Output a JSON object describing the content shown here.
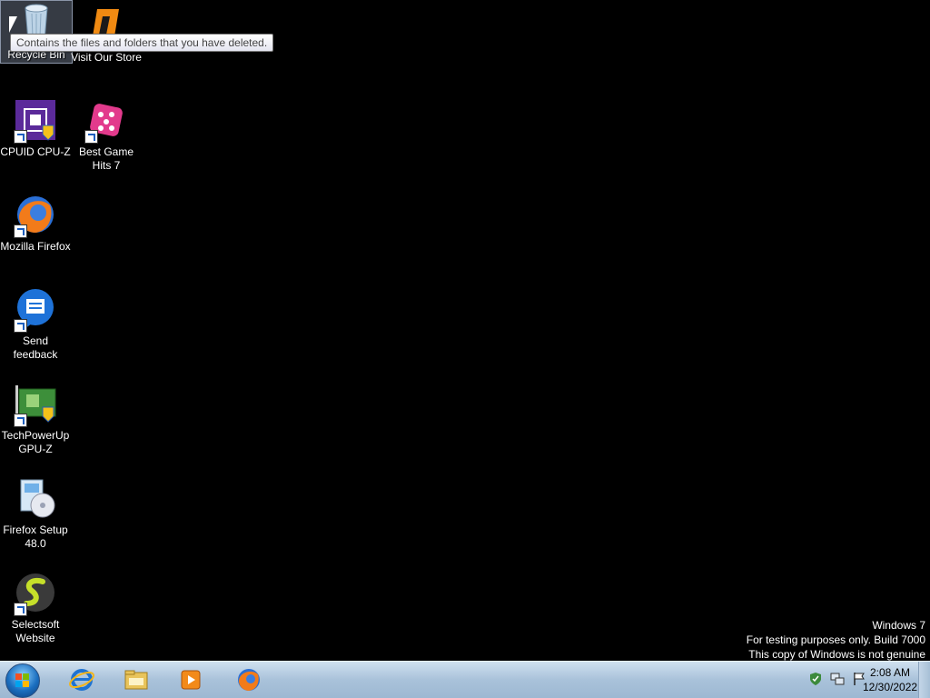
{
  "desktop": {
    "icons": [
      {
        "label": "Recycle Bin",
        "icon": "recycle-bin-icon"
      },
      {
        "label": "Visit Our Store",
        "icon": "store-icon"
      },
      {
        "label": "CPUID CPU-Z",
        "icon": "cpu-z-icon"
      },
      {
        "label": "Best Game Hits 7",
        "icon": "dice-icon"
      },
      {
        "label": "Mozilla Firefox",
        "icon": "firefox-icon"
      },
      {
        "label": "Send feedback",
        "icon": "feedback-icon"
      },
      {
        "label": "TechPowerUp GPU-Z",
        "icon": "gpu-z-icon"
      },
      {
        "label": "Firefox Setup 48.0",
        "icon": "installer-icon"
      },
      {
        "label": "Selectsoft Website",
        "icon": "selectsoft-icon"
      }
    ],
    "tooltip": "Contains the files and folders that you have deleted."
  },
  "watermark": {
    "line1": "Windows 7",
    "line2": "For testing purposes only. Build 7000",
    "line3": "This copy of Windows is not genuine"
  },
  "taskbar": {
    "start_icon": "windows-start-icon",
    "pinned": [
      "internet-explorer-icon",
      "windows-explorer-icon",
      "media-player-icon",
      "firefox-icon"
    ],
    "tray_icons": [
      "security-shield-icon",
      "network-icon",
      "action-center-flag-icon"
    ],
    "clock_time": "2:08 AM",
    "clock_date": "12/30/2022"
  },
  "colors": {
    "desktop_bg": "#000000",
    "taskbar": "#a9c2da"
  }
}
